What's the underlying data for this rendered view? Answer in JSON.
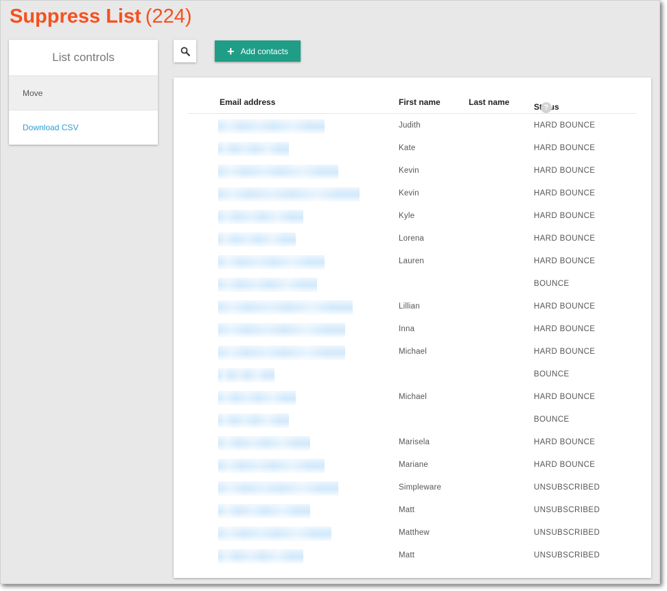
{
  "page": {
    "title": "Suppress List",
    "count": "(224)"
  },
  "list_controls": {
    "header": "List controls",
    "items": [
      {
        "label": "Move"
      },
      {
        "label": "Download CSV"
      }
    ]
  },
  "toolbar": {
    "search_icon": "search-icon",
    "add_contacts_label": "Add contacts"
  },
  "table": {
    "columns": {
      "email": "Email address",
      "first_name": "First name",
      "last_name": "Last name",
      "status": "Status",
      "status_help": "?"
    },
    "rows": [
      {
        "first_name": "Judith",
        "last_name": "",
        "status": "HARD BOUNCE",
        "email_redacted_fraction": 0.75
      },
      {
        "first_name": "Kate",
        "last_name": "",
        "status": "HARD BOUNCE",
        "email_redacted_fraction": 0.5
      },
      {
        "first_name": "Kevin",
        "last_name": "",
        "status": "HARD BOUNCE",
        "email_redacted_fraction": 0.85
      },
      {
        "first_name": "Kevin",
        "last_name": "",
        "status": "HARD BOUNCE",
        "email_redacted_fraction": 1.0
      },
      {
        "first_name": "Kyle",
        "last_name": "",
        "status": "HARD BOUNCE",
        "email_redacted_fraction": 0.6
      },
      {
        "first_name": "Lorena",
        "last_name": "",
        "status": "HARD BOUNCE",
        "email_redacted_fraction": 0.55
      },
      {
        "first_name": "Lauren",
        "last_name": "",
        "status": "HARD BOUNCE",
        "email_redacted_fraction": 0.75
      },
      {
        "first_name": "",
        "last_name": "",
        "status": "BOUNCE",
        "email_redacted_fraction": 0.7
      },
      {
        "first_name": "Lillian",
        "last_name": "",
        "status": "HARD BOUNCE",
        "email_redacted_fraction": 0.95
      },
      {
        "first_name": "Inna",
        "last_name": "",
        "status": "HARD BOUNCE",
        "email_redacted_fraction": 0.9
      },
      {
        "first_name": "Michael",
        "last_name": "",
        "status": "HARD BOUNCE",
        "email_redacted_fraction": 0.9
      },
      {
        "first_name": "",
        "last_name": "",
        "status": "BOUNCE",
        "email_redacted_fraction": 0.4
      },
      {
        "first_name": "Michael",
        "last_name": "",
        "status": "HARD BOUNCE",
        "email_redacted_fraction": 0.55
      },
      {
        "first_name": "",
        "last_name": "",
        "status": "BOUNCE",
        "email_redacted_fraction": 0.5
      },
      {
        "first_name": "Marisela",
        "last_name": "",
        "status": "HARD BOUNCE",
        "email_redacted_fraction": 0.65
      },
      {
        "first_name": "Mariane",
        "last_name": "",
        "status": "HARD BOUNCE",
        "email_redacted_fraction": 0.75
      },
      {
        "first_name": "Simpleware",
        "last_name": "",
        "status": "UNSUBSCRIBED",
        "email_redacted_fraction": 0.85
      },
      {
        "first_name": "Matt",
        "last_name": "",
        "status": "UNSUBSCRIBED",
        "email_redacted_fraction": 0.65
      },
      {
        "first_name": "Matthew",
        "last_name": "",
        "status": "UNSUBSCRIBED",
        "email_redacted_fraction": 0.8
      },
      {
        "first_name": "Matt",
        "last_name": "",
        "status": "UNSUBSCRIBED",
        "email_redacted_fraction": 0.6
      }
    ]
  },
  "colors": {
    "title": "#f4511e",
    "accent_button": "#1f9d87",
    "link": "#2a9fd8"
  }
}
